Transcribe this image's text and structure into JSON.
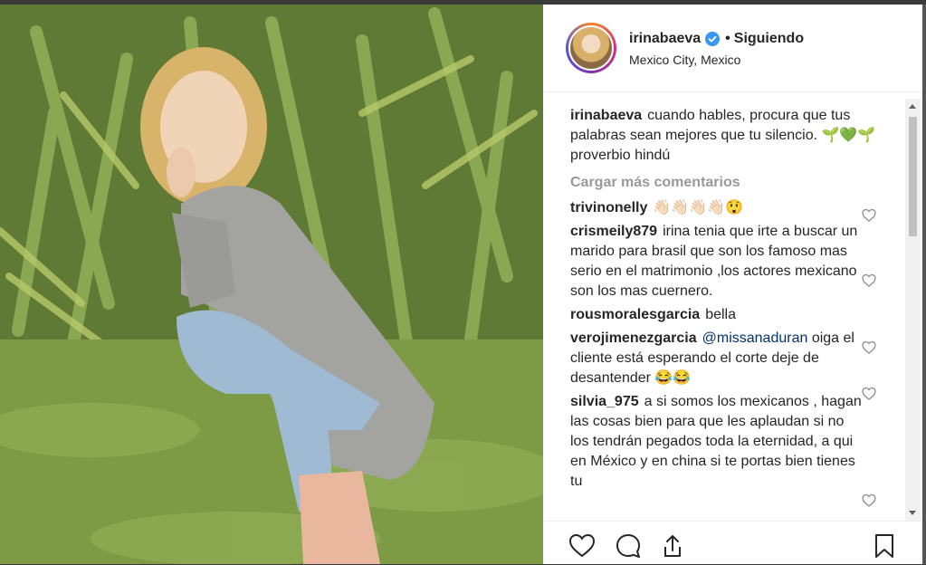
{
  "post": {
    "username": "irinabaeva",
    "separator": "•",
    "follow_state": "Siguiendo",
    "location": "Mexico City, Mexico"
  },
  "caption": {
    "user": "irinabaeva",
    "text": "cuando hables, procura que tus palabras sean mejores que tu silencio. 🌱💚🌱 proverbio hindú"
  },
  "load_more_label": "Cargar más comentarios",
  "comments": [
    {
      "user": "trivinonelly",
      "text": "👋🏻👋🏻👋🏻👋🏻😲"
    },
    {
      "user": "crismeily879",
      "text": "irina tenia que irte a buscar un marido para brasil que son los famoso mas serio en el matrimonio ,los actores mexicano son los mas cuernero."
    },
    {
      "user": "rousmoralesgarcia",
      "text": "bella"
    },
    {
      "user": "verojimenezgarcia",
      "mention": "@missanaduran",
      "text": "oiga el cliente está esperando el corte deje de desantender 😂😂"
    },
    {
      "user": "silvia_975",
      "text": "a si somos los mexicanos , hagan las cosas bien para que les aplaudan si no los tendrán pegados toda la eternidad, a qui en México y en china si te portas bien tienes tu"
    }
  ],
  "icons": {
    "verified": "verified-badge-icon",
    "like": "heart-icon",
    "comment": "comment-icon",
    "share": "share-icon",
    "save": "bookmark-icon"
  },
  "colors": {
    "verified": "#3897f0",
    "muted": "#999999",
    "mention": "#003569"
  }
}
